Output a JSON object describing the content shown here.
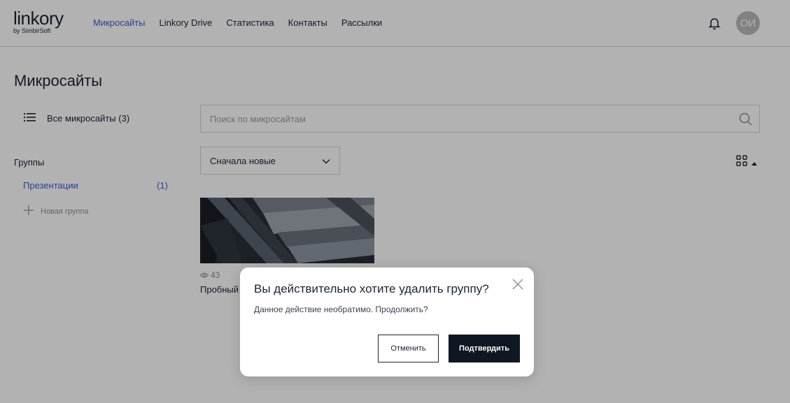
{
  "header": {
    "logo_main": "linkory",
    "logo_sub": "by SimbirSoft",
    "nav": [
      {
        "label": "Микросайты",
        "active": true
      },
      {
        "label": "Linkory Drive",
        "active": false
      },
      {
        "label": "Статистика",
        "active": false
      },
      {
        "label": "Контакты",
        "active": false
      },
      {
        "label": "Рассылки",
        "active": false
      }
    ],
    "notifications_icon": "bell-icon",
    "avatar_initials": "ОИ"
  },
  "page": {
    "title": "Микросайты",
    "all_sites_label": "Все микросайты (3)",
    "groups_title": "Группы",
    "groups": [
      {
        "label": "Презентации",
        "count": "(1)"
      }
    ],
    "new_group_label": "Новая группа"
  },
  "search": {
    "placeholder": "Поиск по микросайтам",
    "value": ""
  },
  "sort": {
    "selected": "Сначала новые"
  },
  "view_toggle_icon": "grid-icon",
  "cards": [
    {
      "views": "43",
      "title": "Пробный"
    }
  ],
  "modal": {
    "title": "Вы действительно хотите удалить группу?",
    "text": "Данное действие необратимо. Продолжить?",
    "cancel_label": "Отменить",
    "confirm_label": "Подтвердить"
  },
  "colors": {
    "accent": "#3b5bcc",
    "text": "#1b2433",
    "confirm_bg": "#0f1722",
    "overlay": "rgba(0,0,0,0.30)"
  }
}
